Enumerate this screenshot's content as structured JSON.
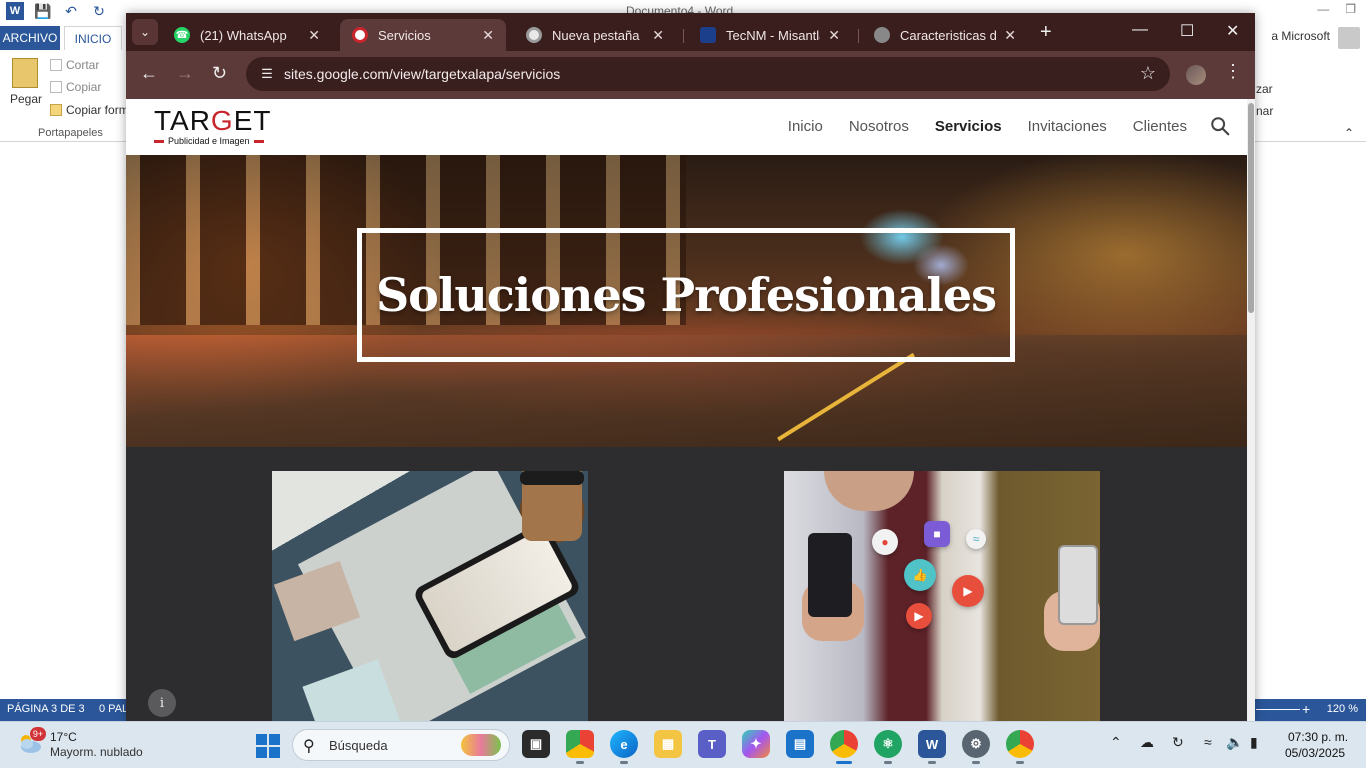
{
  "word": {
    "doc_title": "Documento4 - Word",
    "tab_archivo": "ARCHIVO",
    "tab_inicio": "INICIO",
    "user": "a Microsoft",
    "ribbon": {
      "pegar": "Pegar",
      "cortar": "Cortar",
      "copiar": "Copiar",
      "copiar_formato": "Copiar form",
      "group_label": "Portapapeles",
      "right_a": "zar",
      "right_b": "nar"
    },
    "status": {
      "page": "PÁGINA 3 DE 3",
      "words": "0 PAL",
      "zoom": "120 %"
    }
  },
  "chrome": {
    "tabs": [
      {
        "label": "(21) WhatsApp",
        "icon": "whatsapp-icon",
        "color": "#25d366"
      },
      {
        "label": "Servicios",
        "icon": "target-site-icon",
        "color": "#c9252c"
      },
      {
        "label": "Nueva pestaña",
        "icon": "chrome-icon",
        "color": "#e8e8e8"
      },
      {
        "label": "TecNM - Misantla",
        "icon": "tecnm-icon",
        "color": "#1b3f8b"
      },
      {
        "label": "Caracteristicas de p",
        "icon": "globe-icon",
        "color": "#888888"
      }
    ],
    "active_tab": 1,
    "url": "sites.google.com/view/targetxalapa/servicios"
  },
  "site": {
    "logo_main_a": "TAR",
    "logo_main_g": "G",
    "logo_main_b": "ET",
    "logo_sub": "Publicidad e Imagen",
    "nav": [
      "Inicio",
      "Nosotros",
      "Servicios",
      "Invitaciones",
      "Clientes"
    ],
    "active_nav": "Servicios",
    "hero_title": "Soluciones Profesionales"
  },
  "taskbar": {
    "weather_temp": "17°C",
    "weather_desc": "Mayorm. nublado",
    "weather_badge": "9+",
    "search_placeholder": "Búsqueda",
    "time": "07:30 p. m.",
    "date": "05/03/2025"
  }
}
